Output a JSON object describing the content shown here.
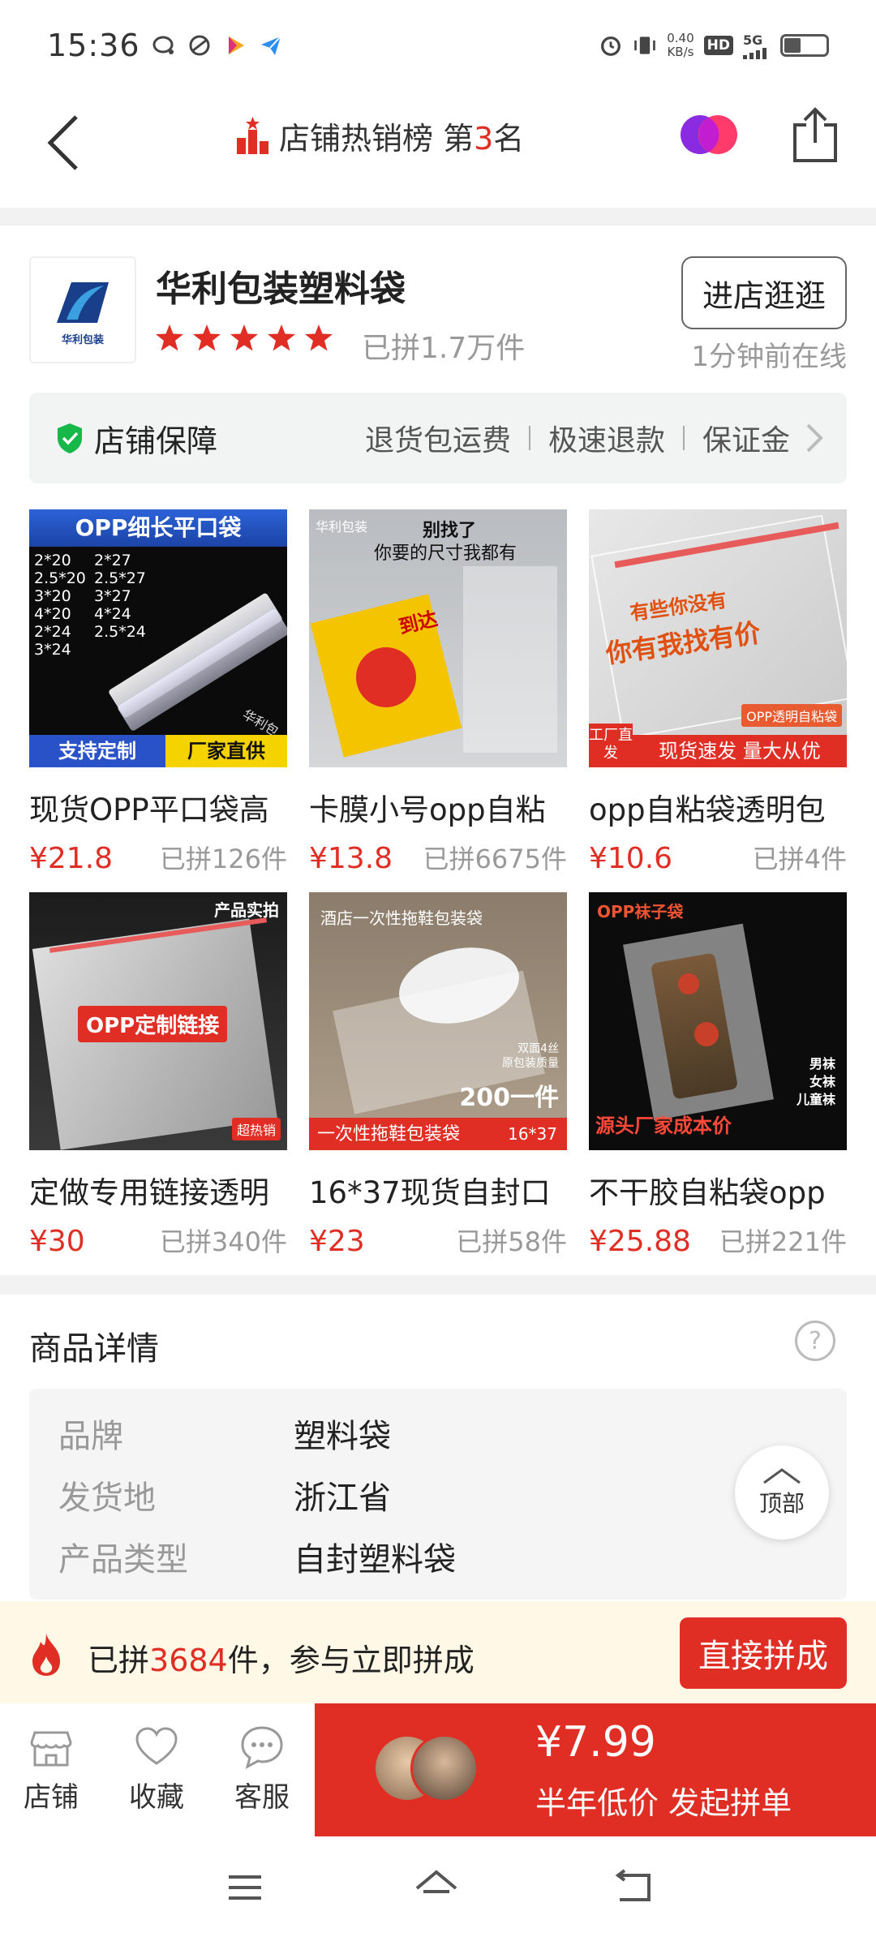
{
  "status_bar": {
    "time": "15:36",
    "net_speed_value": "0.40",
    "net_speed_unit": "KB/s",
    "hd": "HD",
    "network": "5G"
  },
  "header": {
    "title": "店铺热销榜 第",
    "rank": "3",
    "rank_suffix": "名"
  },
  "shop": {
    "name": "华利包装塑料袋",
    "logo_text": "华利包装",
    "rating_stars": 5,
    "sold": "已拼1.7万件",
    "enter_button": "进店逛逛",
    "online_status": "1分钟前在线"
  },
  "guarantee": {
    "title": "店铺保障",
    "items": [
      "退货包运费",
      "极速退款",
      "保证金"
    ]
  },
  "products": [
    {
      "title": "现货OPP平口袋高",
      "price": "¥21.8",
      "sold": "已拼126件",
      "img_top_text": "OPP细长平口袋",
      "img_left_badge": "支持定制",
      "img_right_badge": "厂家直供",
      "img_sizes": [
        "2*20",
        "2*27",
        "2.5*20",
        "2.5*27",
        "3*20",
        "3*27",
        "4*20",
        "4*24",
        "2*24",
        "2.5*24",
        "3*24"
      ],
      "img_watermark": "华利包"
    },
    {
      "title": "卡膜小号opp自粘",
      "price": "¥13.8",
      "sold": "已拼6675件",
      "img_top_text": "别找了",
      "img_sub_text": "你要的尺寸我都有",
      "img_corner": "华利包装",
      "img_card_text": "到达"
    },
    {
      "title": "opp自粘袋透明包",
      "price": "¥10.6",
      "sold": "已拼4件",
      "img_top_text": "有些你没有",
      "img_sub_text": "你有我找有价",
      "img_tag": "OPP透明自粘袋",
      "img_corner": "工厂直发",
      "img_bottom_text": "现货速发 量大从优"
    },
    {
      "title": "定做专用链接透明",
      "price": "¥30",
      "sold": "已拼340件",
      "img_top_text": "产品实拍",
      "img_badge": "OPP定制链接",
      "img_corner": "超热销"
    },
    {
      "title": "16*37现货自封口",
      "price": "¥23",
      "sold": "已拼58件",
      "img_top_text": "酒店一次性拖鞋包装袋",
      "img_mid_text": "200一件",
      "img_side_text": "双面4丝",
      "img_side_text2": "原包装质量",
      "img_bottom_text": "一次性拖鞋包装袋",
      "img_bottom_size": "16*37"
    },
    {
      "title": "不干胶自粘袋opp",
      "price": "¥25.88",
      "sold": "已拼221件",
      "img_top_text": "OPP袜子袋",
      "img_bottom_text": "源头厂家成本价",
      "img_side_text": "男袜",
      "img_side_text2": "女袜",
      "img_side_text3": "儿童袜"
    }
  ],
  "details": {
    "title": "商品详情",
    "help": "?",
    "rows": [
      {
        "key": "品牌",
        "value": "塑料袋"
      },
      {
        "key": "发货地",
        "value": "浙江省"
      },
      {
        "key": "产品类型",
        "value": "自封塑料袋"
      }
    ],
    "top_button": "顶部"
  },
  "group_banner": {
    "prefix": "已拼",
    "count": "3684",
    "suffix": "件，参与立即拼成",
    "button": "直接拼成"
  },
  "bottom_bar": {
    "tabs": [
      "店铺",
      "收藏",
      "客服"
    ],
    "price": "¥7.99",
    "subtitle": "半年低价 发起拼单"
  },
  "colors": {
    "accent": "#e02e24",
    "star": "#e02e24",
    "banner_bg": "#fff8e6"
  }
}
